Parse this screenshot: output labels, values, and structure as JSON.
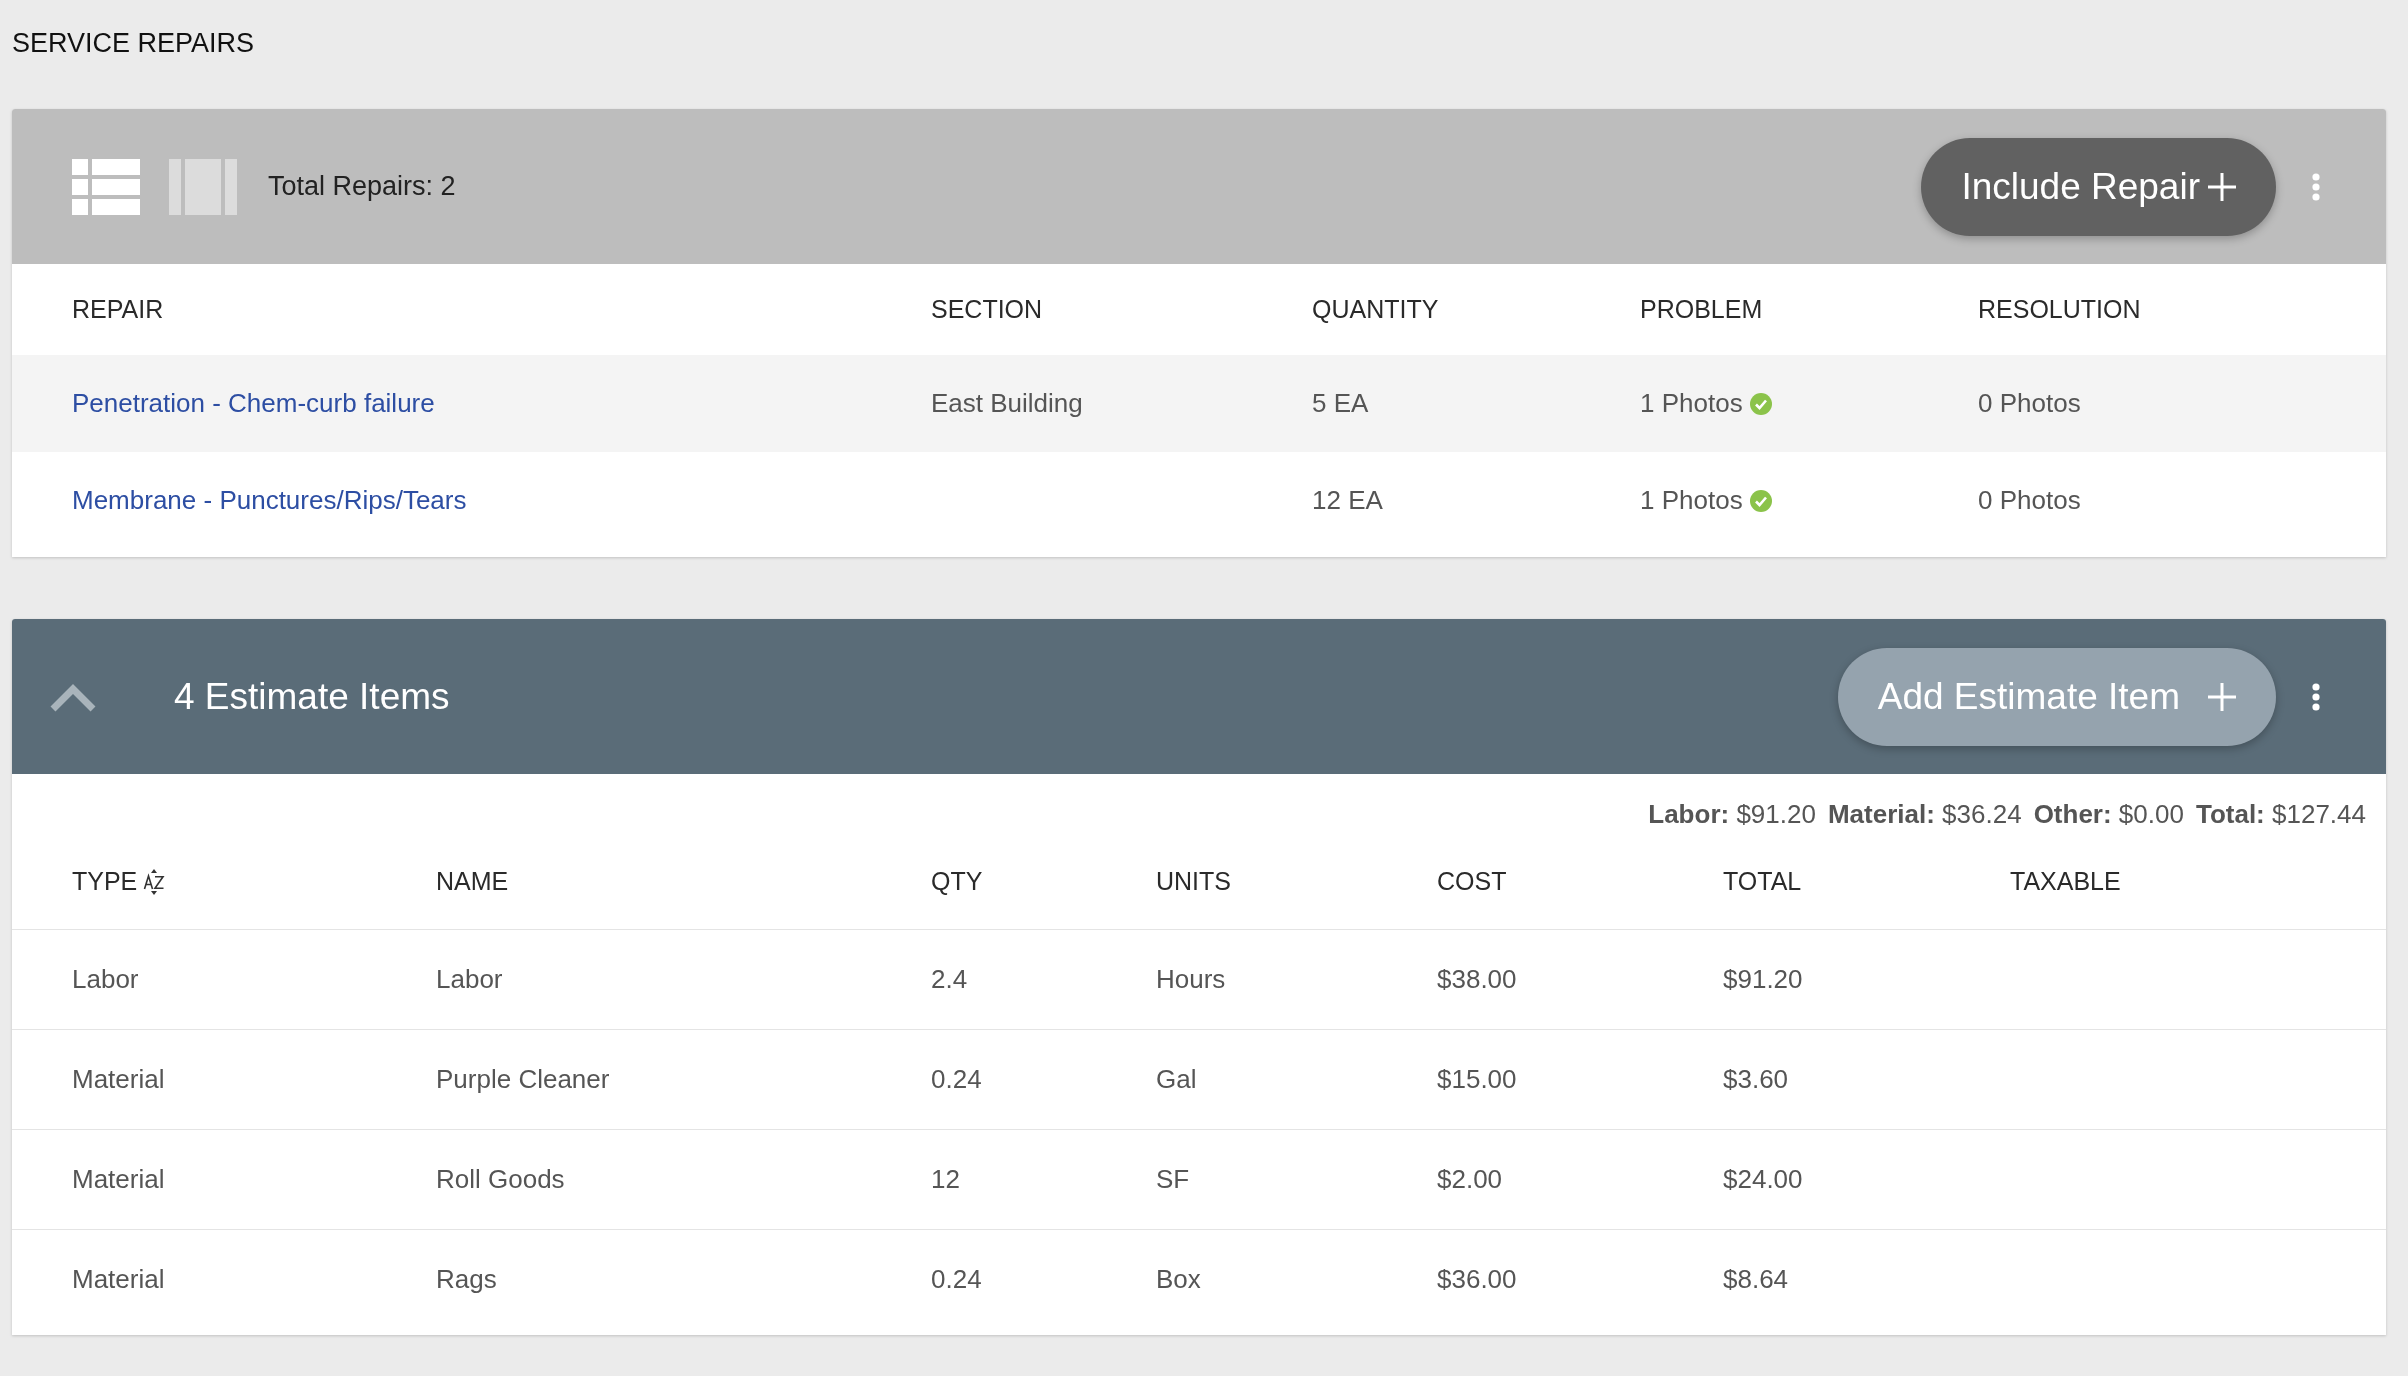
{
  "page": {
    "title": "SERVICE REPAIRS"
  },
  "repairs": {
    "view_toggles": [
      {
        "kind": "list",
        "selected": true
      },
      {
        "kind": "cards",
        "selected": false
      }
    ],
    "total": "Total Repairs: 2",
    "add_button": "Include Repair",
    "columns": [
      "REPAIR",
      "SECTION",
      "QUANTITY",
      "PROBLEM",
      "RESOLUTION"
    ],
    "rows": [
      {
        "repair": "Penetration - Chem-curb failure",
        "section": "East Building",
        "quantity": "5 EA",
        "problem": "1 Photos",
        "problem_confirmed": true,
        "resolution": "0 Photos"
      },
      {
        "repair": "Membrane - Punctures/Rips/Tears",
        "quantity": "12 EA",
        "problem": "1 Photos",
        "problem_confirmed": true,
        "resolution": "0 Photos"
      }
    ]
  },
  "estimate": {
    "expanded": true,
    "title": "4 Estimate Items",
    "add_button": "Add Estimate Item",
    "totals": [
      {
        "label": "Labor:",
        "value": "$91.20"
      },
      {
        "label": "Material:",
        "value": "$36.24"
      },
      {
        "label": "Other:",
        "value": "$0.00"
      },
      {
        "label": "Total:",
        "value": "$127.44"
      }
    ],
    "columns": [
      {
        "label": "TYPE",
        "sorted": true
      },
      {
        "label": "NAME",
        "sorted": false
      },
      {
        "label": "QTY",
        "sorted": false
      },
      {
        "label": "UNITS",
        "sorted": false
      },
      {
        "label": "COST",
        "sorted": false
      },
      {
        "label": "TOTAL",
        "sorted": false
      },
      {
        "label": "TAXABLE",
        "sorted": false
      }
    ],
    "rows": [
      {
        "type": "Labor",
        "name": "Labor",
        "qty": "2.4",
        "units": "Hours",
        "cost": "$38.00",
        "total": "$91.20"
      },
      {
        "type": "Material",
        "name": "Purple Cleaner",
        "qty": "0.24",
        "units": "Gal",
        "cost": "$15.00",
        "total": "$3.60"
      },
      {
        "type": "Material",
        "name": "Roll Goods",
        "qty": "12",
        "units": "SF",
        "cost": "$2.00",
        "total": "$24.00"
      },
      {
        "type": "Material",
        "name": "Rags",
        "qty": "0.24",
        "units": "Box",
        "cost": "$36.00",
        "total": "$8.64"
      }
    ]
  }
}
